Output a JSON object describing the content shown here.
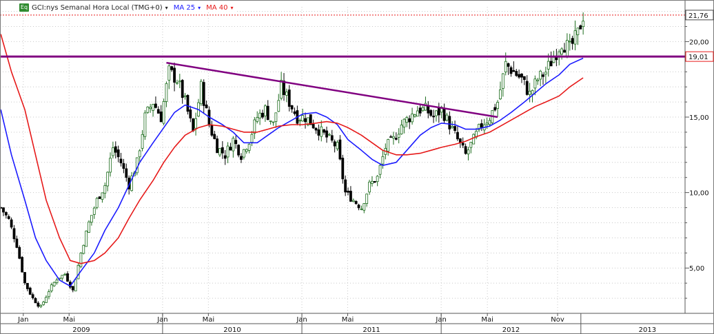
{
  "header": {
    "badge": "Eq",
    "title": "GCI:nys Semanal Hora Local (TMG+0)",
    "ma1_label": "MA 25",
    "ma2_label": "MA 40",
    "menu_glyph": "▾"
  },
  "chart_data": {
    "type": "candlestick",
    "title": "GCI:nys Semanal Hora Local (TMG+0)",
    "xlabel": "",
    "ylabel": "",
    "x_range": [
      "2008-11",
      "2013-10"
    ],
    "ylim": [
      2.0,
      22.3
    ],
    "scale": "linear",
    "grid": true,
    "price_last": 21.76,
    "price_last_label": "21,76",
    "resistance": 19.01,
    "resistance_label": "19,01",
    "y_ticks": [
      {
        "value": 5,
        "label": "5,00"
      },
      {
        "value": 10,
        "label": "10,00"
      },
      {
        "value": 15,
        "label": "15,00"
      },
      {
        "value": 20,
        "label": "20,00"
      }
    ],
    "month_ticks": [
      {
        "date": "2009-01",
        "label": "Jan"
      },
      {
        "date": "2009-05",
        "label": "Mai"
      },
      {
        "date": "2010-01",
        "label": "Jan"
      },
      {
        "date": "2010-05",
        "label": "Mai"
      },
      {
        "date": "2011-01",
        "label": "Jan"
      },
      {
        "date": "2011-05",
        "label": "Mai"
      },
      {
        "date": "2012-01",
        "label": "Jan"
      },
      {
        "date": "2012-05",
        "label": "Mai"
      },
      {
        "date": "2012-11",
        "label": "Nov"
      }
    ],
    "year_ticks": [
      {
        "date": "2009-01",
        "label": "2009"
      },
      {
        "date": "2010-01",
        "label": "2010"
      },
      {
        "date": "2011-01",
        "label": "2011"
      },
      {
        "date": "2012-01",
        "label": "2012"
      },
      {
        "date": "2013-01",
        "label": "2013"
      }
    ],
    "close_path": [
      [
        "2008-11-03",
        9.0
      ],
      [
        "2008-11-24",
        8.2
      ],
      [
        "2008-12-15",
        6.5
      ],
      [
        "2009-01-05",
        4.0
      ],
      [
        "2009-01-26",
        3.0
      ],
      [
        "2009-02-16",
        2.4
      ],
      [
        "2009-03-09",
        3.5
      ],
      [
        "2009-03-30",
        4.3
      ],
      [
        "2009-04-20",
        4.6
      ],
      [
        "2009-05-11",
        3.5
      ],
      [
        "2009-06-01",
        6.0
      ],
      [
        "2009-06-22",
        8.0
      ],
      [
        "2009-07-13",
        9.5
      ],
      [
        "2009-08-03",
        10.5
      ],
      [
        "2009-08-24",
        13.0
      ],
      [
        "2009-09-14",
        12.0
      ],
      [
        "2009-10-05",
        10.5
      ],
      [
        "2009-10-26",
        12.0
      ],
      [
        "2009-11-16",
        15.0
      ],
      [
        "2009-12-07",
        16.0
      ],
      [
        "2009-12-28",
        15.0
      ],
      [
        "2010-01-18",
        18.0
      ],
      [
        "2010-02-08",
        17.5
      ],
      [
        "2010-03-01",
        16.0
      ],
      [
        "2010-03-22",
        14.0
      ],
      [
        "2010-04-12",
        17.0
      ],
      [
        "2010-05-03",
        14.5
      ],
      [
        "2010-05-24",
        13.0
      ],
      [
        "2010-06-14",
        12.5
      ],
      [
        "2010-07-05",
        13.5
      ],
      [
        "2010-07-26",
        12.5
      ],
      [
        "2010-08-16",
        13.5
      ],
      [
        "2010-09-06",
        15.0
      ],
      [
        "2010-09-27",
        15.5
      ],
      [
        "2010-10-18",
        14.5
      ],
      [
        "2010-11-08",
        17.0
      ],
      [
        "2010-11-29",
        16.0
      ],
      [
        "2010-12-20",
        15.0
      ],
      [
        "2011-01-10",
        15.0
      ],
      [
        "2011-01-31",
        14.5
      ],
      [
        "2011-02-21",
        14.0
      ],
      [
        "2011-03-14",
        13.5
      ],
      [
        "2011-04-04",
        13.0
      ],
      [
        "2011-04-25",
        10.0
      ],
      [
        "2011-05-16",
        9.5
      ],
      [
        "2011-06-06",
        9.0
      ],
      [
        "2011-06-27",
        10.5
      ],
      [
        "2011-07-18",
        11.0
      ],
      [
        "2011-08-08",
        13.0
      ],
      [
        "2011-08-29",
        13.5
      ],
      [
        "2011-09-19",
        14.5
      ],
      [
        "2011-10-10",
        15.0
      ],
      [
        "2011-10-31",
        15.5
      ],
      [
        "2011-11-21",
        15.5
      ],
      [
        "2011-12-12",
        15.0
      ],
      [
        "2012-01-02",
        15.5
      ],
      [
        "2012-01-23",
        14.5
      ],
      [
        "2012-02-13",
        13.5
      ],
      [
        "2012-03-05",
        12.5
      ],
      [
        "2012-03-26",
        13.5
      ],
      [
        "2012-04-16",
        14.5
      ],
      [
        "2012-05-07",
        15.0
      ],
      [
        "2012-05-28",
        16.0
      ],
      [
        "2012-06-18",
        18.5
      ],
      [
        "2012-07-09",
        18.0
      ],
      [
        "2012-07-30",
        17.5
      ],
      [
        "2012-08-20",
        16.5
      ],
      [
        "2012-09-10",
        17.5
      ],
      [
        "2012-10-01",
        18.0
      ],
      [
        "2012-10-22",
        19.0
      ],
      [
        "2012-11-12",
        20.0
      ],
      [
        "2012-12-03",
        19.5
      ],
      [
        "2012-12-24",
        20.5
      ],
      [
        "2013-01-07",
        21.76
      ]
    ],
    "series": [
      {
        "name": "MA 25",
        "color": "#1a1aff",
        "points": [
          [
            "2008-11-03",
            15.5
          ],
          [
            "2008-12-01",
            12.5
          ],
          [
            "2009-01-05",
            9.5
          ],
          [
            "2009-02-02",
            7.0
          ],
          [
            "2009-03-02",
            5.5
          ],
          [
            "2009-04-06",
            4.2
          ],
          [
            "2009-05-04",
            3.8
          ],
          [
            "2009-06-01",
            4.8
          ],
          [
            "2009-07-06",
            6.0
          ],
          [
            "2009-08-03",
            7.5
          ],
          [
            "2009-09-07",
            9.0
          ],
          [
            "2009-10-05",
            10.5
          ],
          [
            "2009-11-02",
            12.0
          ],
          [
            "2009-12-07",
            13.3
          ],
          [
            "2010-01-04",
            14.3
          ],
          [
            "2010-02-01",
            15.3
          ],
          [
            "2010-03-01",
            15.8
          ],
          [
            "2010-04-05",
            15.5
          ],
          [
            "2010-05-03",
            15.0
          ],
          [
            "2010-06-07",
            14.5
          ],
          [
            "2010-07-05",
            14.0
          ],
          [
            "2010-08-02",
            13.3
          ],
          [
            "2010-09-06",
            13.3
          ],
          [
            "2010-10-04",
            13.8
          ],
          [
            "2010-11-01",
            14.3
          ],
          [
            "2010-12-06",
            14.8
          ],
          [
            "2011-01-03",
            15.2
          ],
          [
            "2011-02-07",
            15.3
          ],
          [
            "2011-03-07",
            15.0
          ],
          [
            "2011-04-04",
            14.5
          ],
          [
            "2011-05-02",
            13.5
          ],
          [
            "2011-06-06",
            12.8
          ],
          [
            "2011-07-04",
            12.2
          ],
          [
            "2011-08-01",
            11.8
          ],
          [
            "2011-09-05",
            12.0
          ],
          [
            "2011-10-03",
            12.8
          ],
          [
            "2011-11-07",
            13.8
          ],
          [
            "2011-12-05",
            14.3
          ],
          [
            "2012-01-02",
            14.6
          ],
          [
            "2012-02-06",
            14.5
          ],
          [
            "2012-03-05",
            14.2
          ],
          [
            "2012-04-02",
            14.2
          ],
          [
            "2012-05-07",
            14.4
          ],
          [
            "2012-06-04",
            14.8
          ],
          [
            "2012-07-02",
            15.3
          ],
          [
            "2012-08-06",
            16.0
          ],
          [
            "2012-09-03",
            16.6
          ],
          [
            "2012-10-01",
            17.2
          ],
          [
            "2012-11-05",
            17.8
          ],
          [
            "2012-12-03",
            18.5
          ],
          [
            "2013-01-07",
            18.9
          ]
        ]
      },
      {
        "name": "MA 40",
        "color": "#e61919",
        "points": [
          [
            "2008-11-03",
            20.5
          ],
          [
            "2008-12-01",
            18.0
          ],
          [
            "2009-01-05",
            15.5
          ],
          [
            "2009-02-02",
            12.5
          ],
          [
            "2009-03-02",
            9.5
          ],
          [
            "2009-04-06",
            7.0
          ],
          [
            "2009-05-04",
            5.5
          ],
          [
            "2009-06-01",
            5.3
          ],
          [
            "2009-07-06",
            5.5
          ],
          [
            "2009-08-03",
            6.0
          ],
          [
            "2009-09-07",
            7.0
          ],
          [
            "2009-10-05",
            8.3
          ],
          [
            "2009-11-02",
            9.5
          ],
          [
            "2009-12-07",
            10.8
          ],
          [
            "2010-01-04",
            12.0
          ],
          [
            "2010-02-01",
            13.0
          ],
          [
            "2010-03-01",
            13.8
          ],
          [
            "2010-04-05",
            14.3
          ],
          [
            "2010-05-03",
            14.5
          ],
          [
            "2010-06-07",
            14.4
          ],
          [
            "2010-07-05",
            14.2
          ],
          [
            "2010-08-02",
            14.0
          ],
          [
            "2010-09-06",
            14.0
          ],
          [
            "2010-10-04",
            14.2
          ],
          [
            "2010-11-01",
            14.4
          ],
          [
            "2010-12-06",
            14.5
          ],
          [
            "2011-01-03",
            14.5
          ],
          [
            "2011-02-07",
            14.6
          ],
          [
            "2011-03-07",
            14.7
          ],
          [
            "2011-04-04",
            14.6
          ],
          [
            "2011-05-02",
            14.3
          ],
          [
            "2011-06-06",
            13.8
          ],
          [
            "2011-07-04",
            13.3
          ],
          [
            "2011-08-01",
            12.8
          ],
          [
            "2011-09-05",
            12.5
          ],
          [
            "2011-10-03",
            12.5
          ],
          [
            "2011-11-07",
            12.6
          ],
          [
            "2011-12-05",
            12.8
          ],
          [
            "2012-01-02",
            13.0
          ],
          [
            "2012-02-06",
            13.2
          ],
          [
            "2012-03-05",
            13.4
          ],
          [
            "2012-04-02",
            13.7
          ],
          [
            "2012-05-07",
            14.0
          ],
          [
            "2012-06-04",
            14.4
          ],
          [
            "2012-07-02",
            14.8
          ],
          [
            "2012-08-06",
            15.3
          ],
          [
            "2012-09-03",
            15.7
          ],
          [
            "2012-10-01",
            16.0
          ],
          [
            "2012-11-05",
            16.4
          ],
          [
            "2012-12-03",
            17.0
          ],
          [
            "2013-01-07",
            17.6
          ]
        ]
      }
    ],
    "lines": [
      {
        "name": "resistance",
        "color": "#800080",
        "points": [
          [
            "2008-11-03",
            19.01
          ],
          [
            "2013-10-28",
            19.01
          ]
        ]
      },
      {
        "name": "trendline",
        "color": "#800080",
        "points": [
          [
            "2010-01-11",
            18.6
          ],
          [
            "2012-05-28",
            15.0
          ]
        ]
      }
    ],
    "colors": {
      "up": "#1b6b1b",
      "down": "#000000",
      "ma25": "#1a1aff",
      "ma40": "#e61919",
      "trend": "#800080",
      "grid": "#c8c8c8"
    }
  }
}
